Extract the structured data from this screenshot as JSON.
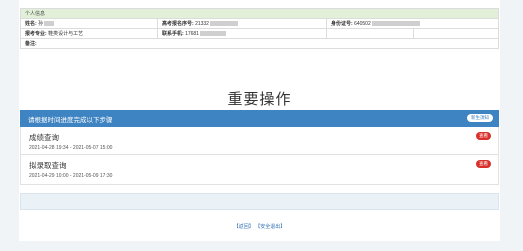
{
  "info": {
    "section_title": "个人信息",
    "name_label": "姓名:",
    "name_value": "孙",
    "exam_no_label": "高考报名序号:",
    "exam_no_value": "21332",
    "id_label": "身份证号:",
    "id_value": "640502",
    "major_label": "报考专业:",
    "major_value": "鞋类设计与工艺",
    "phone_label": "联系手机:",
    "phone_value": "17681",
    "remark_label": "备注:"
  },
  "title": "重要操作",
  "panel": {
    "header": "请根据时间进度完成以下步骤",
    "header_button": "新生須知",
    "steps": [
      {
        "name": "成绩查询",
        "time": "2021-04-28 19:34 - 2021-05-07 15:00",
        "badge": "查看"
      },
      {
        "name": "拟录取查询",
        "time": "2021-04-29 10:00 - 2021-05-09 17:30",
        "badge": "查看"
      }
    ]
  },
  "footer": {
    "back": "【返回】",
    "logout": "【安全退出】"
  }
}
